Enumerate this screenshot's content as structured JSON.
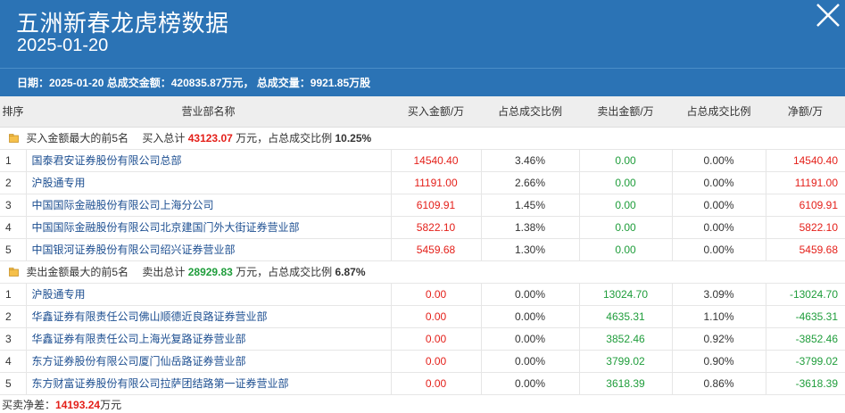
{
  "header": {
    "title": "五洲新春龙虎榜数据",
    "date": "2025-01-20",
    "summary": "日期：2025-01-20 总成交金额：420835.87万元， 总成交量：9921.85万股"
  },
  "columns": [
    "排序",
    "营业部名称",
    "买入金额/万",
    "占总成交比例",
    "卖出金额/万",
    "占总成交比例",
    "净额/万"
  ],
  "buy_section": {
    "label": "买入金额最大的前5名",
    "total_prefix": "买入总计",
    "total": "43123.07",
    "unit_text": "万元，占总成交比例",
    "ratio": "10.25%",
    "rows": [
      {
        "rank": "1",
        "name": "国泰君安证券股份有限公司总部",
        "buy": "14540.40",
        "buy_ratio": "3.46%",
        "sell": "0.00",
        "sell_ratio": "0.00%",
        "net": "14540.40"
      },
      {
        "rank": "2",
        "name": "沪股通专用",
        "buy": "11191.00",
        "buy_ratio": "2.66%",
        "sell": "0.00",
        "sell_ratio": "0.00%",
        "net": "11191.00"
      },
      {
        "rank": "3",
        "name": "中国国际金融股份有限公司上海分公司",
        "buy": "6109.91",
        "buy_ratio": "1.45%",
        "sell": "0.00",
        "sell_ratio": "0.00%",
        "net": "6109.91"
      },
      {
        "rank": "4",
        "name": "中国国际金融股份有限公司北京建国门外大街证券营业部",
        "buy": "5822.10",
        "buy_ratio": "1.38%",
        "sell": "0.00",
        "sell_ratio": "0.00%",
        "net": "5822.10"
      },
      {
        "rank": "5",
        "name": "中国银河证券股份有限公司绍兴证券营业部",
        "buy": "5459.68",
        "buy_ratio": "1.30%",
        "sell": "0.00",
        "sell_ratio": "0.00%",
        "net": "5459.68"
      }
    ]
  },
  "sell_section": {
    "label": "卖出金额最大的前5名",
    "total_prefix": "卖出总计",
    "total": "28929.83",
    "unit_text": "万元，占总成交比例",
    "ratio": "6.87%",
    "rows": [
      {
        "rank": "1",
        "name": "沪股通专用",
        "buy": "0.00",
        "buy_ratio": "0.00%",
        "sell": "13024.70",
        "sell_ratio": "3.09%",
        "net": "-13024.70"
      },
      {
        "rank": "2",
        "name": "华鑫证券有限责任公司佛山顺德近良路证券营业部",
        "buy": "0.00",
        "buy_ratio": "0.00%",
        "sell": "4635.31",
        "sell_ratio": "1.10%",
        "net": "-4635.31"
      },
      {
        "rank": "3",
        "name": "华鑫证券有限责任公司上海光复路证券营业部",
        "buy": "0.00",
        "buy_ratio": "0.00%",
        "sell": "3852.46",
        "sell_ratio": "0.92%",
        "net": "-3852.46"
      },
      {
        "rank": "4",
        "name": "东方证券股份有限公司厦门仙岳路证券营业部",
        "buy": "0.00",
        "buy_ratio": "0.00%",
        "sell": "3799.02",
        "sell_ratio": "0.90%",
        "net": "-3799.02"
      },
      {
        "rank": "5",
        "name": "东方财富证券股份有限公司拉萨团结路第一证券营业部",
        "buy": "0.00",
        "buy_ratio": "0.00%",
        "sell": "3618.39",
        "sell_ratio": "0.86%",
        "net": "-3618.39"
      }
    ]
  },
  "footer": {
    "label": "买卖净差：",
    "value": "14193.24",
    "unit": "万元"
  },
  "colors": {
    "header_bg": "#2b73b5",
    "buy_red": "#e4201a",
    "sell_green": "#1f9d3b",
    "name_blue": "#1d4f91"
  }
}
